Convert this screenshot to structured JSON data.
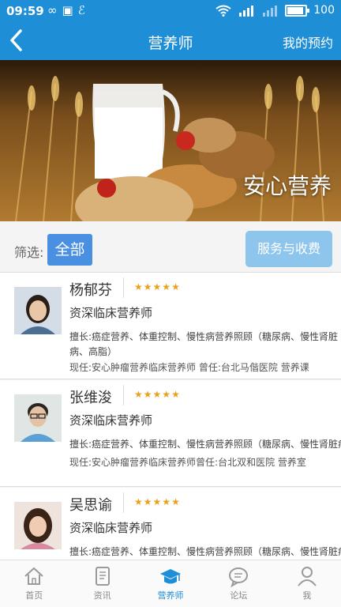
{
  "status": {
    "time": "09:59",
    "battery": "100",
    "battery_level": 1.0
  },
  "header": {
    "title": "营养师",
    "appointment_label": "我的预约"
  },
  "banner": {
    "caption": "安心营养"
  },
  "filter": {
    "label": "筛选:",
    "all_label": "全部",
    "service_label": "服务与收费"
  },
  "nutritionists": [
    {
      "name": "杨郁芬",
      "rating": 5,
      "title": "资深临床营养师",
      "specialty": "擅长:癌症营养、体重控制、慢性病营养照顾（糖尿病、慢性肾脏病、高脂）",
      "current": "现任:安心肿瘤营养临床营养师  曾任:台北马偕医院 营养课"
    },
    {
      "name": "张维浚",
      "rating": 5,
      "title": "资深临床营养师",
      "specialty": "擅长:癌症营养、体重控制、慢性病营养照顾（糖尿病、慢性肾脏病、高",
      "current": "现任:安心肿瘤营养临床营养师曾任:台北双和医院 营养室"
    },
    {
      "name": "吴思谕",
      "rating": 5,
      "title": "资深临床营养师",
      "specialty": "擅长:癌症营养、体重控制、慢性病营养照顾（糖尿病、慢性肾脏病、高",
      "current": ""
    }
  ],
  "tabs": [
    {
      "label": "首页",
      "icon": "home-icon"
    },
    {
      "label": "资讯",
      "icon": "news-icon"
    },
    {
      "label": "营养师",
      "icon": "graduation-cap-icon"
    },
    {
      "label": "论坛",
      "icon": "chat-icon"
    },
    {
      "label": "我",
      "icon": "user-icon"
    }
  ],
  "colors": {
    "primary": "#1e8ed6",
    "star": "#e8a21a",
    "filter_active": "#4a90e2",
    "service_button": "#8ec5ec"
  }
}
